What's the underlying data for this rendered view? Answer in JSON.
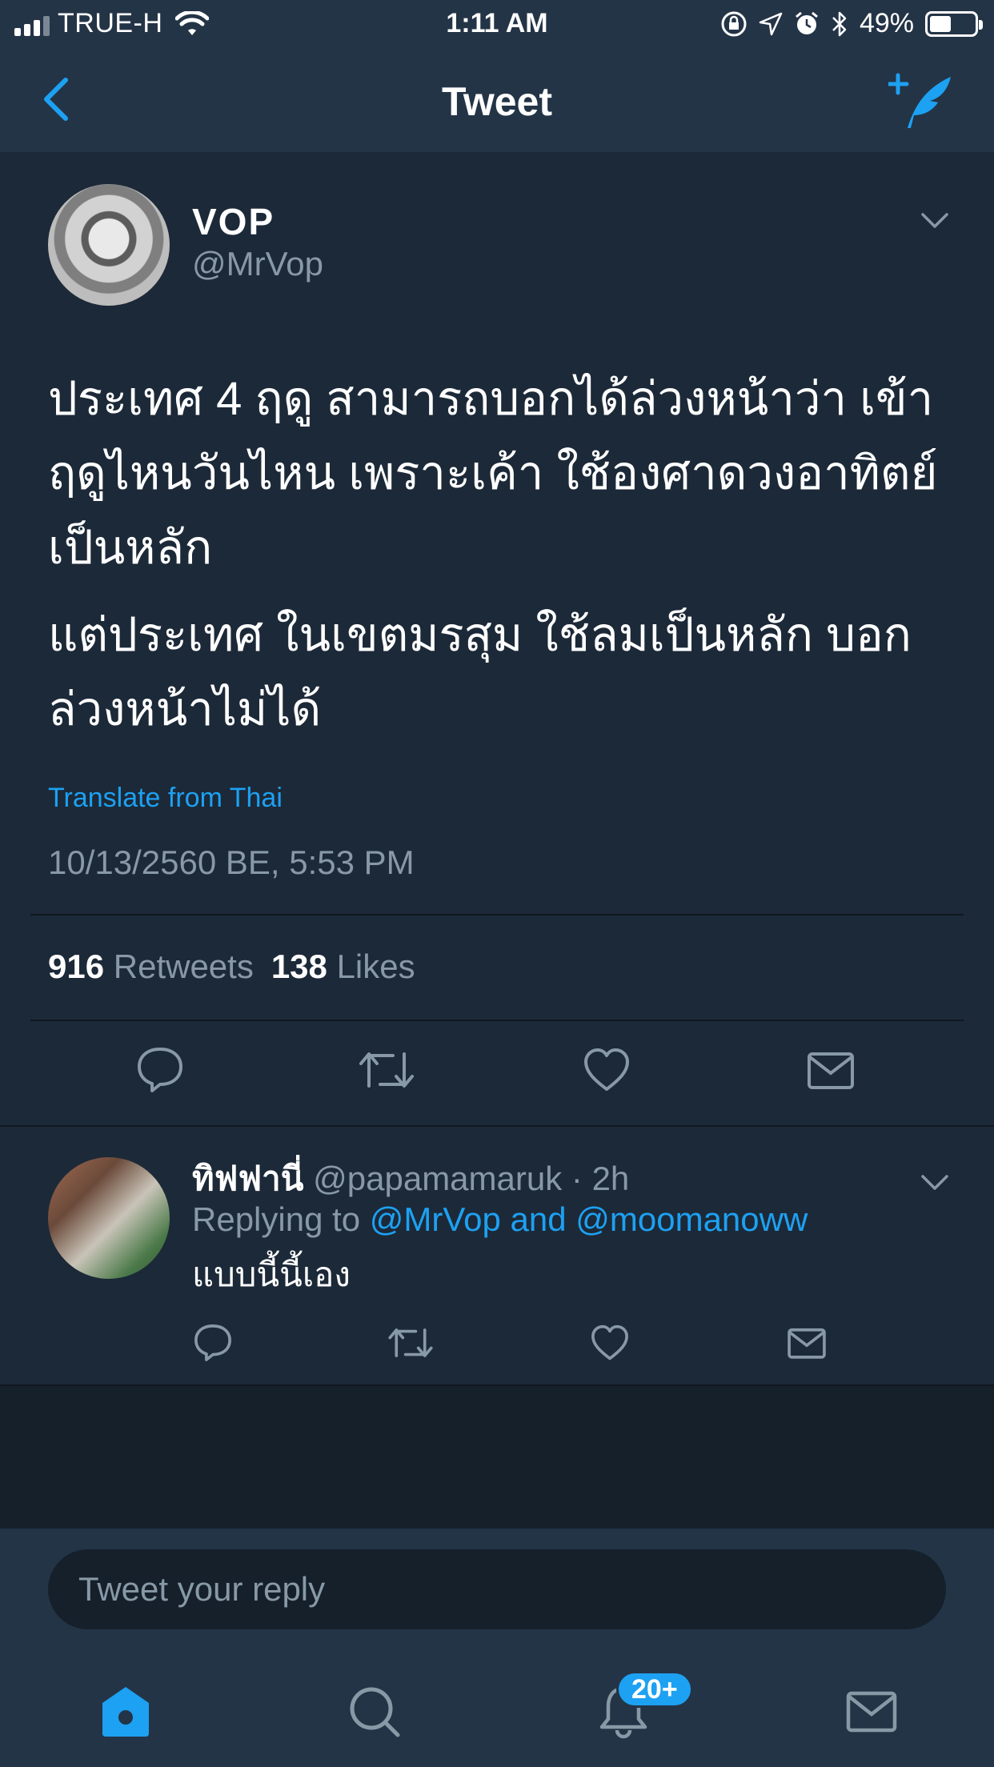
{
  "status_bar": {
    "carrier": "TRUE-H",
    "time": "1:11 AM",
    "battery": "49%",
    "battery_level": 0.49
  },
  "nav": {
    "title": "Tweet"
  },
  "tweet": {
    "name": "VOP",
    "handle": "@MrVop",
    "paragraph_1": "ประเทศ 4 ฤดู สามารถบอกได้ล่วงหน้าว่า เข้าฤดูไหนวันไหน เพราะเค้า ใช้องศาดวงอาทิตย์เป็นหลัก",
    "paragraph_2": "แต่ประเทศ ในเขตมรสุม ใช้ลมเป็นหลัก บอกล่วงหน้าไม่ได้",
    "translate_label": "Translate from Thai",
    "timestamp": "10/13/2560 BE, 5:53 PM",
    "retweets_count": "916",
    "retweets_label": "Retweets",
    "likes_count": "138",
    "likes_label": "Likes"
  },
  "reply": {
    "name": "ทิฟฟานี่",
    "handle": "@papamamaruk",
    "separator": "·",
    "age": "2h",
    "replying_prefix": "Replying to",
    "replying_to_1": "@MrVop",
    "replying_and": "and",
    "replying_to_2": "@moomanoww",
    "text": "แบบนี้นี้เอง"
  },
  "composer": {
    "placeholder": "Tweet your reply"
  },
  "tabbar": {
    "notifications_badge": "20+",
    "active_tab": "home"
  },
  "colors": {
    "accent": "#1da1f2",
    "background": "#15202b",
    "card": "#1c2938",
    "bar": "#243447",
    "muted_text": "#8899a6"
  },
  "icons": [
    "back-chevron-icon",
    "compose-tweet-icon",
    "chevron-down-icon",
    "reply-icon",
    "retweet-icon",
    "like-icon",
    "direct-message-icon",
    "home-icon",
    "search-icon",
    "notifications-bell-icon",
    "messages-icon"
  ]
}
